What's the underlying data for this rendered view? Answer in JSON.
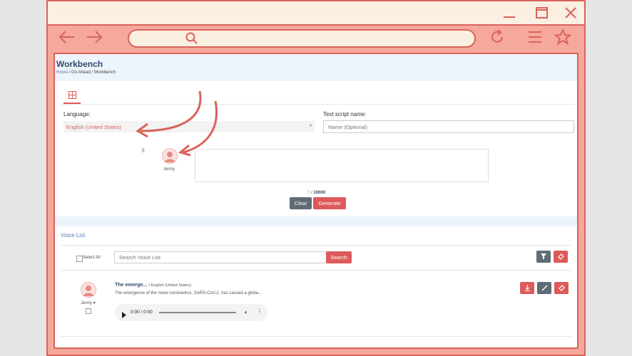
{
  "page": {
    "title": "Workbench",
    "breadcrumb": [
      "Home",
      "Go Ahead",
      "Workbench"
    ],
    "grid_icon": "grid-icon"
  },
  "form": {
    "language_label": "Language:",
    "language_value": "English (United States)",
    "script_label": "Text script name:",
    "script_placeholder": "Name (Optional)",
    "voice_name": "Jenny",
    "char_count": "0",
    "char_limit": "10000",
    "clear_label": "Clear",
    "generate_label": "Generate"
  },
  "voice_list": {
    "title": "Voice List",
    "select_all": "Select All",
    "search_placeholder": "Search Voice List",
    "search_label": "Search",
    "items": [
      {
        "title": "The emerge...",
        "language": "English (United States)",
        "description": "The emergence of the novel coronavirus, SARS-CoV-2, has caused a globa...",
        "voice": "Jenny",
        "audio_time": "0:00 / 0:00"
      }
    ]
  },
  "colors": {
    "accent": "#dd5a5a",
    "frame": "#f6a89c",
    "frame_border": "#d9635a",
    "title_color": "#2f4a6d",
    "gray_button": "#5f6b75"
  }
}
